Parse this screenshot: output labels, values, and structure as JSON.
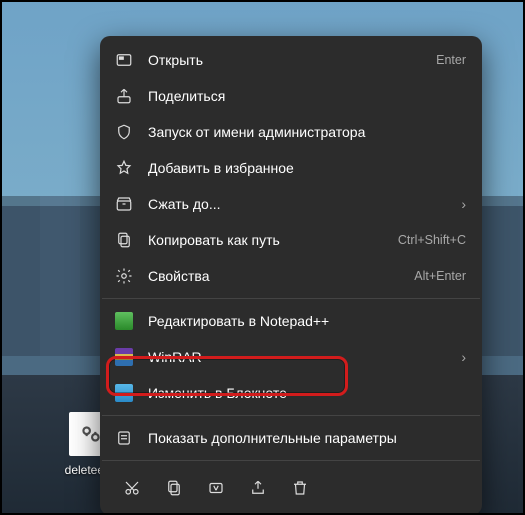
{
  "desktop": {
    "file_label": "deleteedg"
  },
  "menu": {
    "open": {
      "label": "Открыть",
      "shortcut": "Enter"
    },
    "share": {
      "label": "Поделиться"
    },
    "run_admin": {
      "label": "Запуск от имени администратора"
    },
    "favorite": {
      "label": "Добавить в избранное"
    },
    "compress": {
      "label": "Сжать до..."
    },
    "copy_path": {
      "label": "Копировать как путь",
      "shortcut": "Ctrl+Shift+C"
    },
    "properties": {
      "label": "Свойства",
      "shortcut": "Alt+Enter"
    },
    "npp": {
      "label": "Редактировать в Notepad++"
    },
    "winrar": {
      "label": "WinRAR"
    },
    "notepad": {
      "label": "Изменить в Блокноте"
    },
    "more": {
      "label": "Показать дополнительные параметры"
    }
  },
  "chevron": "›"
}
